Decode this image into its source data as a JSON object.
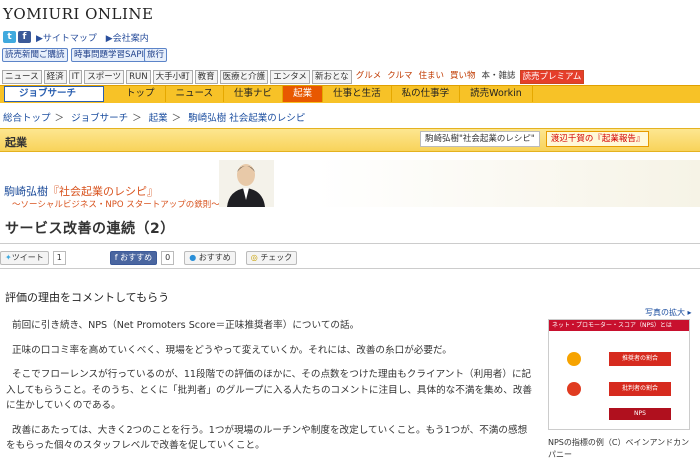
{
  "site": {
    "logo": "YOMIURI ONLINE",
    "link_sitemap": "▶サイトマップ",
    "link_company": "▶会社案内"
  },
  "service_buttons": [
    "読売新聞ご購読",
    "時事問題学習SAPIX",
    "旅行"
  ],
  "top_nav": [
    "ニュース",
    "経済",
    "IT",
    "スポーツ",
    "RUN",
    "大手小町",
    "教育",
    "医療と介護",
    "エンタメ",
    "新おとな",
    "グルメ",
    "クルマ",
    "住まい",
    "買い物",
    "本・雑誌",
    "読売プレミアム"
  ],
  "jobsearch": {
    "logo": "ジョブサーチ",
    "tabs": [
      "トップ",
      "ニュース",
      "仕事ナビ",
      "起業",
      "仕事と生活",
      "私の仕事学",
      "読売Workin"
    ],
    "active": "起業"
  },
  "breadcrumb": [
    "総合トップ",
    "ジョブサーチ",
    "起業",
    "駒崎弘樹 社会起業のレシピ"
  ],
  "section": {
    "title": "起業",
    "link1": "駒崎弘樹\"社会起業のレシピ\"",
    "link2": "渡辺千賀の『起業報告』"
  },
  "banner": {
    "name": "駒崎弘樹",
    "series": "『社会起業のレシピ』",
    "subtitle": "〜ソーシャルビジネス・NPO スタートアップの鉄則〜"
  },
  "article": {
    "title": "サービス改善の連続（2）",
    "lead": "評価の理由をコメントしてもらう",
    "paragraphs": [
      "前回に引き続き、NPS（Net Promoters Score＝正味推奨者率）についての話。",
      "正味の口コミ率を高めていくべく、現場をどうやって変えていくか。それには、改善の糸口が必要だ。",
      "そこでフローレンスが行っているのが、11段階での評価のほかに、その点数をつけた理由もクライアント（利用者）に記入してもらうこと。そのうち、とくに「批判者」のグループに入る人たちのコメントに注目し、具体的な不満を集め、改善に生かしていくのである。",
      "改善にあたっては、大きく2つのことを行う。1つが現場のルーチンや制度を改定していくこと。もう1つが、不満の感想をもらった個々のスタッフレベルで改善を促していくこと。"
    ]
  },
  "share": {
    "tweet": "ツイート",
    "tweet_count": "1",
    "fb": "おすすめ",
    "fb_count": "0",
    "mixi": "おすすめ",
    "check": "チェック"
  },
  "figure": {
    "enlarge": "写真の拡大",
    "caption": "NPSの指標の例（C）ベインアンドカンパニー",
    "header": "ネット・プロモーター・スコア（NPS）とは",
    "row1": "推奨者の割合",
    "row2": "批判者の割合",
    "result": "NPS"
  }
}
